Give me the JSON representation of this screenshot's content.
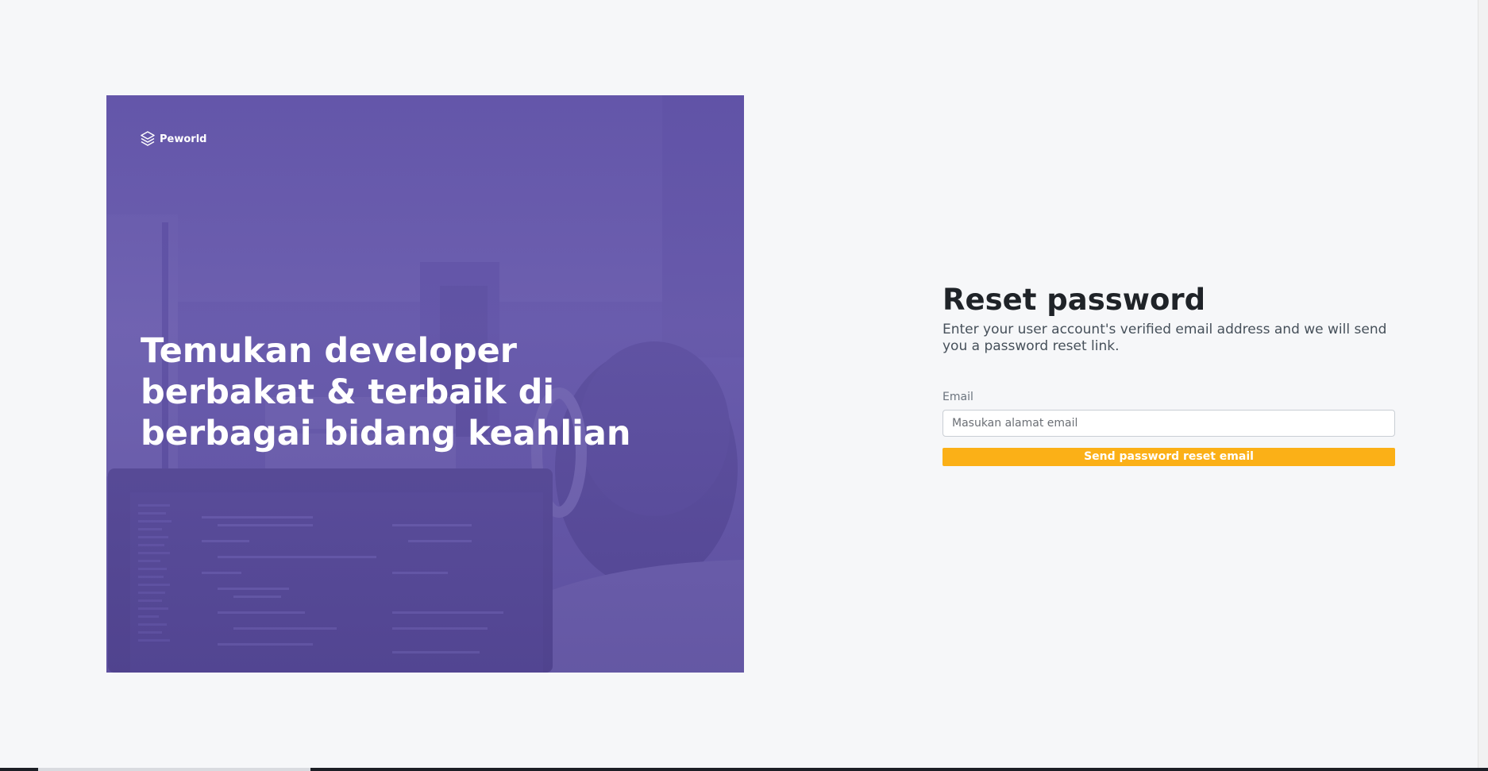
{
  "brand": {
    "name": "Peworld",
    "icon": "layers-icon"
  },
  "hero": {
    "headline": "Temukan developer berbakat & terbaik di berbagai bidang keahlian"
  },
  "form": {
    "title": "Reset password",
    "subtitle": "Enter your user account's verified email address and we will send you a password reset link.",
    "email_label": "Email",
    "email_placeholder": "Masukan alamat email",
    "email_value": "",
    "submit_label": "Send password reset email"
  },
  "colors": {
    "accent": "#fbb017",
    "hero_overlay": "#5e4fa2",
    "background": "#f6f7f9"
  }
}
